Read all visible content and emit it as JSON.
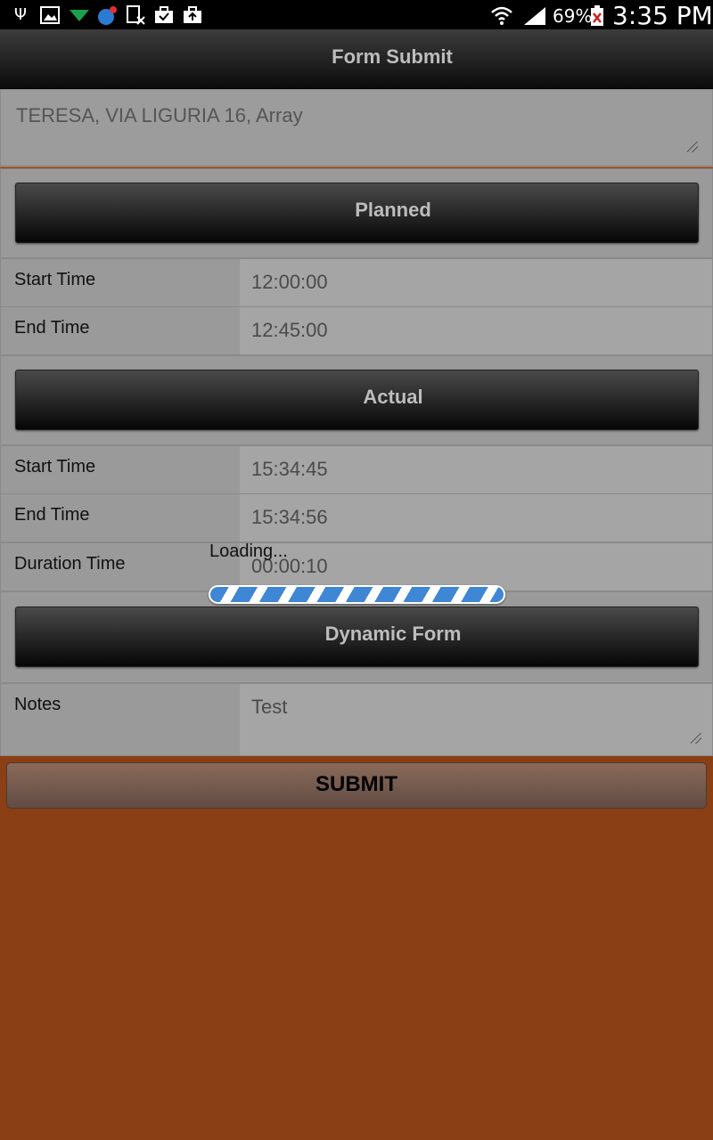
{
  "status_bar": {
    "icons": [
      "usb-icon",
      "image-icon",
      "download-icon",
      "globe-icon",
      "file-icon",
      "briefcase-check-icon",
      "briefcase-upload-icon",
      "wifi-icon",
      "signal-icon",
      "battery-icon"
    ],
    "battery": "69%",
    "time": "3:35 PM"
  },
  "header": {
    "title": "Form Submit"
  },
  "address": {
    "value": "TERESA, VIA LIGURIA 16, Array"
  },
  "planned": {
    "button_label": "Planned",
    "start_label": "Start Time",
    "start_value": "12:00:00",
    "end_label": "End Time",
    "end_value": "12:45:00"
  },
  "actual": {
    "button_label": "Actual",
    "start_label": "Start Time",
    "start_value": "15:34:45",
    "end_label": "End Time",
    "end_value": "15:34:56",
    "duration_label": "Duration Time",
    "duration_value": "00:00:10"
  },
  "loading": {
    "text": "Loading..."
  },
  "dynamic_form": {
    "button_label": "Dynamic Form"
  },
  "notes": {
    "label": "Notes",
    "value": "Test"
  },
  "submit": {
    "label": "SUBMIT"
  },
  "colors": {
    "background": "#8b3f14",
    "header": "#1a1a1a",
    "panel": "#9a9a9a",
    "loading_bar": "#3f86d4"
  }
}
